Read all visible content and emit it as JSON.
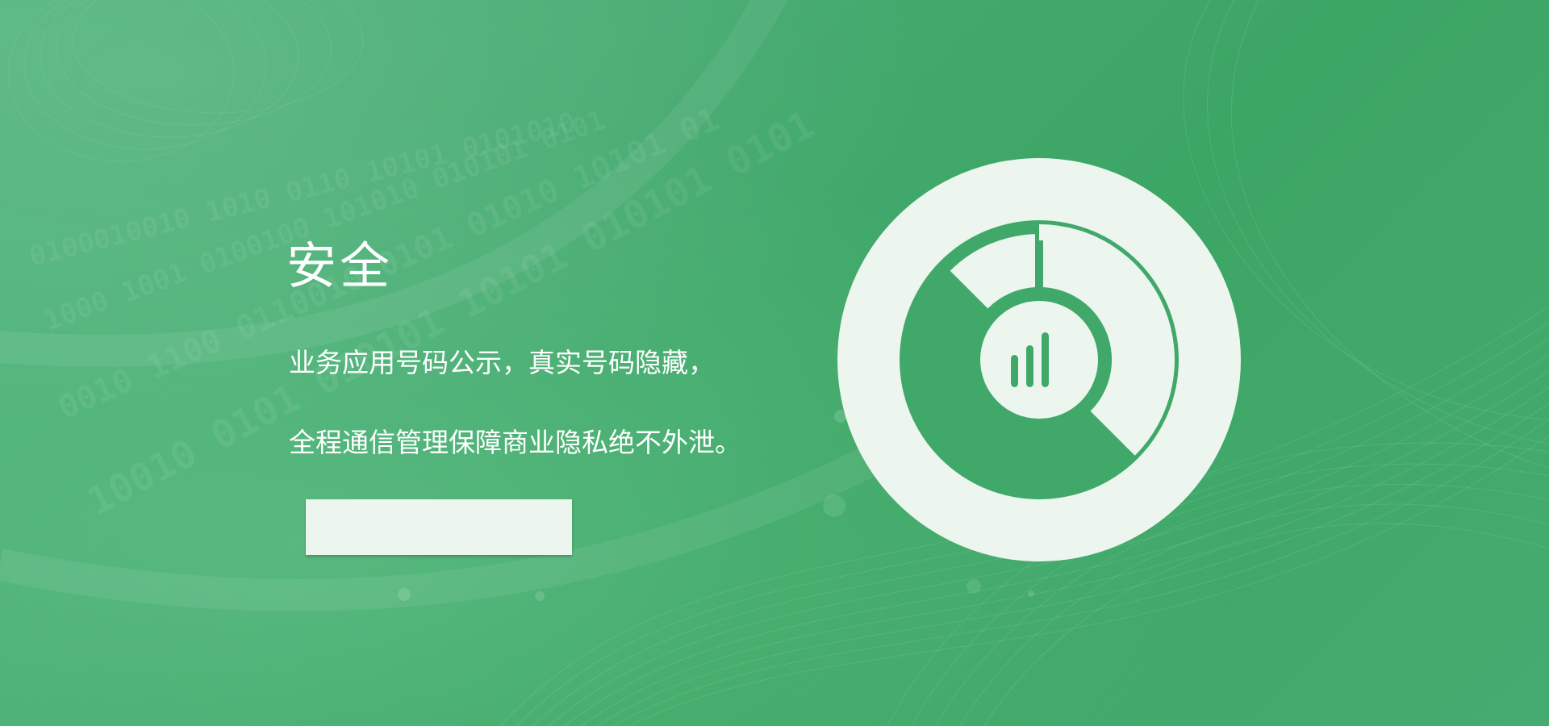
{
  "hero": {
    "title": "安全",
    "description_lines": [
      "业务应用号码公示，真实号码隐藏，",
      "全程通信管理保障商业隐私绝不外泄。"
    ],
    "cta_label": ""
  },
  "emblem": {
    "icon": "security-gauge-icon",
    "inner_icon": "signal-bars-icon"
  },
  "colors": {
    "background": "#44aa6f",
    "accent_green": "#3ca665",
    "pale": "#ecf6ef",
    "text": "#ffffff"
  }
}
